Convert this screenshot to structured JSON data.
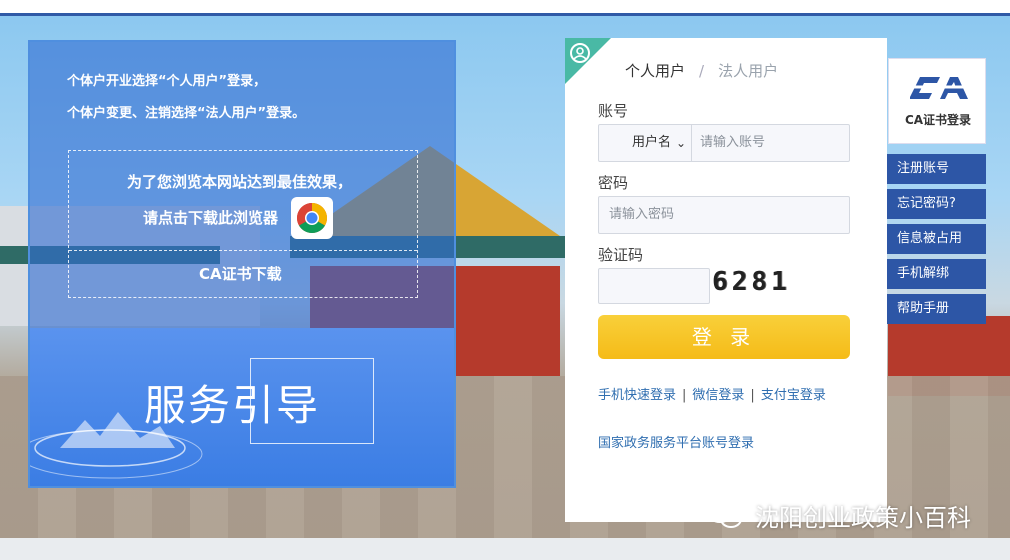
{
  "notice": {
    "line1": "个体户开业选择“个人用户”登录，",
    "line2": "个体户变更、注销选择“法人用户”登录。"
  },
  "download": {
    "line1": "为了您浏览本网站达到最佳效果，",
    "line2": "请点击下载此浏览器",
    "browser_icon": "chrome-icon",
    "ca_download": "CA证书下载"
  },
  "guide": {
    "title": "服务引导"
  },
  "login": {
    "tabs": [
      {
        "label": "个人用户",
        "active": true
      },
      {
        "label": "法人用户",
        "active": false
      }
    ],
    "tab_separator": "/",
    "account": {
      "label": "账号",
      "type_select": "用户名",
      "placeholder": "请输入账号"
    },
    "password": {
      "label": "密码",
      "placeholder": "请输入密码"
    },
    "captcha": {
      "label": "验证码",
      "value": "",
      "image_text": "6281"
    },
    "submit": "登 录",
    "alt_logins": [
      "手机快速登录",
      "微信登录",
      "支付宝登录"
    ],
    "gov_login": "国家政务服务平台账号登录"
  },
  "ca": {
    "logo_icon": "ca-logo-icon",
    "label": "CA证书登录"
  },
  "side_menu": [
    "注册账号",
    "忘记密码?",
    "信息被占用",
    "手机解绑",
    "帮助手册"
  ],
  "watermark": {
    "icon": "wechat-icon",
    "text": "沈阳创业政策小百科"
  },
  "colors": {
    "header_border": "#2f5aa6",
    "side_button": "#2d56a6",
    "login_button": "#f5bb18",
    "link": "#2f6eb0",
    "corner_badge": "#49b9a5"
  }
}
